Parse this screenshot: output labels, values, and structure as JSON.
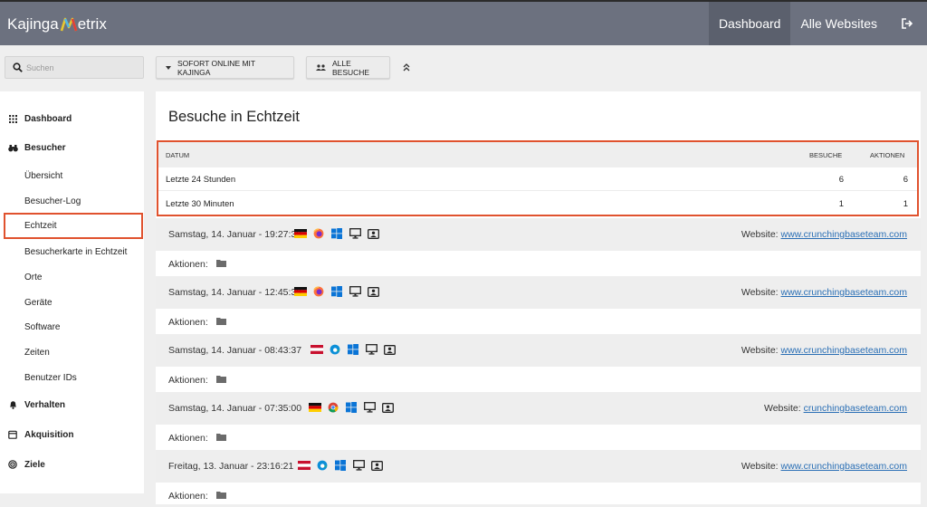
{
  "app": {
    "logo_left": "Kajinga",
    "logo_right": "etrix"
  },
  "nav": {
    "items": [
      {
        "label": "Dashboard"
      },
      {
        "label": "Alle Websites"
      }
    ]
  },
  "search": {
    "placeholder": "Suchen"
  },
  "toolbar": {
    "online_label": "SOFORT ONLINE MIT KAJINGA",
    "all_visits_label": "ALLE BESUCHE"
  },
  "sidebar": {
    "dashboard": "Dashboard",
    "besucher": "Besucher",
    "sub": [
      "Übersicht",
      "Besucher-Log",
      "Echtzeit",
      "Besucherkarte in Echtzeit",
      "Orte",
      "Geräte",
      "Software",
      "Zeiten",
      "Benutzer IDs"
    ],
    "verhalten": "Verhalten",
    "akquisition": "Akquisition",
    "ziele": "Ziele"
  },
  "panel": {
    "title": "Besuche in Echtzeit",
    "summary": {
      "headers": {
        "datum": "DATUM",
        "besuche": "BESUCHE",
        "aktionen": "AKTIONEN"
      },
      "rows": [
        {
          "label": "Letzte 24 Stunden",
          "besuche": "6",
          "aktionen": "6"
        },
        {
          "label": "Letzte 30 Minuten",
          "besuche": "1",
          "aktionen": "1"
        }
      ]
    },
    "visits": [
      {
        "datetime": "Samstag, 14. Januar - 19:27:33",
        "flag": "de",
        "browser": "firefox",
        "site_label": "Website:",
        "site": "www.crunchingbaseteam.com",
        "actions_label": "Aktionen:"
      },
      {
        "datetime": "Samstag, 14. Januar - 12:45:39",
        "flag": "de",
        "browser": "firefox",
        "site_label": "Website:",
        "site": "www.crunchingbaseteam.com",
        "actions_label": "Aktionen:"
      },
      {
        "datetime": "Samstag, 14. Januar - 08:43:37",
        "flag": "at",
        "browser": "edge",
        "site_label": "Website:",
        "site": "www.crunchingbaseteam.com",
        "actions_label": "Aktionen:"
      },
      {
        "datetime": "Samstag, 14. Januar - 07:35:00",
        "flag": "de",
        "browser": "chrome",
        "site_label": "Website:",
        "site": "crunchingbaseteam.com",
        "actions_label": "Aktionen:"
      },
      {
        "datetime": "Freitag, 13. Januar - 23:16:21",
        "flag": "at",
        "browser": "edge",
        "site_label": "Website:",
        "site": "www.crunchingbaseteam.com",
        "actions_label": "Aktionen:"
      }
    ]
  },
  "colors": {
    "topbar": "#6c717f",
    "highlight": "#e0522e",
    "link": "#2a6fb5"
  }
}
